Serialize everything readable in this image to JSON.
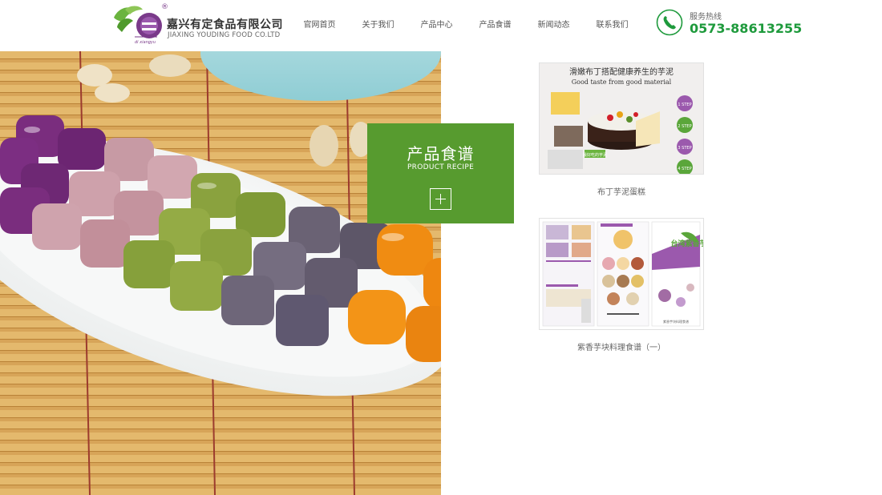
{
  "header": {
    "logo": {
      "company_cn": "嘉兴有定食品有限公司",
      "company_en": "JIAXING YOUDING FOOD CO.LTD",
      "mark_sub": "di xiangyu",
      "registered": "®"
    },
    "nav": [
      {
        "label": "官网首页"
      },
      {
        "label": "关于我们"
      },
      {
        "label": "产品中心"
      },
      {
        "label": "产品食谱"
      },
      {
        "label": "新闻动态"
      },
      {
        "label": "联系我们"
      }
    ],
    "hotline": {
      "label": "服务热线",
      "number": "0573-88613255",
      "color": "#1e9a3c"
    }
  },
  "section": {
    "title_cn": "产品食谱",
    "title_en": "PRODUCT RECIPE",
    "accent": "#579b2f",
    "more_icon": "plus-icon"
  },
  "recipes": [
    {
      "title": "布丁芋泥蛋糕",
      "thumb_headline": "滑嫩布丁搭配健康养生的芋泥",
      "thumb_sub": "Good taste from good material",
      "thumb_steps": [
        "1 STEP",
        "2 STEP",
        "3 STEP",
        "4 STEP"
      ],
      "thumb_caption": "最好吃的芋泥"
    },
    {
      "title": "紫香芋块料理食谱（一）",
      "thumb_brand": "台湾紫香芋",
      "thumb_label": "紫香芋块料理食谱"
    }
  ]
}
